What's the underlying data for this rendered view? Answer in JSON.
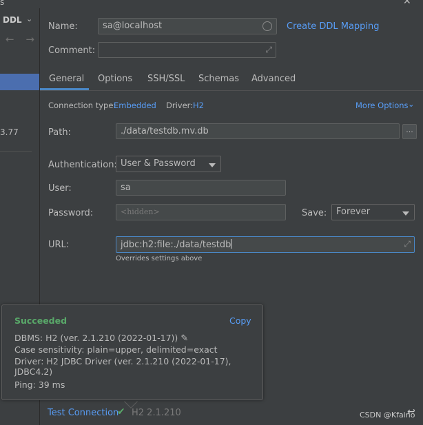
{
  "sidebar": {
    "title": "DDL",
    "arrows": "← →",
    "visible_number": "3.77"
  },
  "form": {
    "name_label": "Name:",
    "name_value": "sa@localhost",
    "create_ddl_mapping": "Create DDL Mapping",
    "comment_label": "Comment:",
    "comment_value": ""
  },
  "tabs": [
    {
      "label": "General"
    },
    {
      "label": "Options"
    },
    {
      "label": "SSH/SSL"
    },
    {
      "label": "Schemas"
    },
    {
      "label": "Advanced"
    }
  ],
  "general": {
    "connection_type_label": "Connection type:",
    "connection_type_value": "Embedded",
    "driver_label": "Driver:",
    "driver_value": "H2",
    "more_options": "More Options",
    "path_label": "Path:",
    "path_value": "./data/testdb.mv.db",
    "browse_label": "...",
    "auth_label": "Authentication:",
    "auth_value": "User & Password",
    "user_label": "User:",
    "user_value": "sa",
    "password_label": "Password:",
    "password_placeholder": "<hidden>",
    "save_label": "Save:",
    "save_value": "Forever",
    "url_label": "URL:",
    "url_value": "jdbc:h2:file:./data/testdb",
    "url_hint": "Overrides settings above"
  },
  "popup": {
    "status": "Succeeded",
    "copy": "Copy",
    "dbms": "DBMS: H2 (ver. 2.1.210 (2022-01-17))",
    "case_sensitivity": "Case sensitivity: plain=upper, delimited=exact",
    "driver": "Driver: H2 JDBC Driver (ver. 2.1.210 (2022-01-17), JDBC4.2)",
    "ping": "Ping: 39 ms"
  },
  "footer": {
    "test_connection": "Test Connection",
    "driver_version": "H2 2.1.210",
    "watermark": "CSDN @Kfaino"
  },
  "colors": {
    "background": "#3c3f41",
    "field": "#45494a",
    "link": "#589df6",
    "success": "#59a869",
    "selection": "#4b6eaf"
  }
}
